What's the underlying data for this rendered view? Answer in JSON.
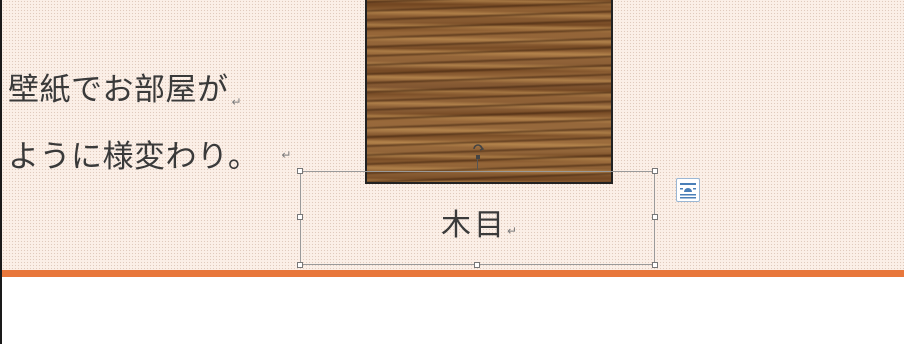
{
  "document": {
    "lines": [
      "壁紙でお部屋が",
      "ように様変わり。"
    ],
    "paragraph_mark": "↵",
    "caption": "木目"
  },
  "colors": {
    "accent_rule": "#e8773b",
    "band_background": "#fbefe7",
    "text": "#3a3a3a"
  },
  "icons": {
    "rotate": "rotate-handle-icon",
    "layout_options": "layout-options-icon"
  }
}
